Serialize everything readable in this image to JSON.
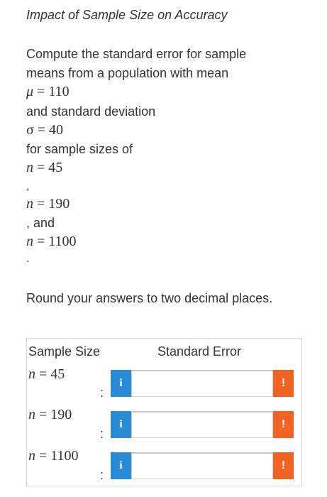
{
  "title": "Impact of Sample Size on Accuracy",
  "problem": {
    "line1": "Compute the standard error for sample",
    "line2": "means from a population with mean",
    "mu_symbol": "μ",
    "mu_rest": " = 110",
    "line3": "and standard deviation",
    "sigma_text": "σ = 40",
    "line4": "for sample sizes of",
    "n_symbol": "n",
    "n1_rest": " = 45",
    "comma1": ",",
    "n2_rest": " = 190",
    "and_text": ", and",
    "n3_rest": " = 1100",
    "period": ".",
    "round_instruction": "Round your answers to two decimal places."
  },
  "table": {
    "col_sample_size": "Sample Size",
    "col_standard_error": "Standard Error",
    "colon": ":",
    "info_label": "i",
    "warn_label": "!",
    "rows": [
      {
        "n_symbol": "n",
        "n_rest": " = 45",
        "value": ""
      },
      {
        "n_symbol": "n",
        "n_rest": " = 190",
        "value": ""
      },
      {
        "n_symbol": "n",
        "n_rest": " = 1100",
        "value": ""
      }
    ]
  },
  "colors": {
    "info": "#2b8ad6",
    "warning": "#f26322",
    "text": "#333333"
  },
  "icons": {
    "info": "info-icon",
    "warning": "exclamation-icon"
  }
}
